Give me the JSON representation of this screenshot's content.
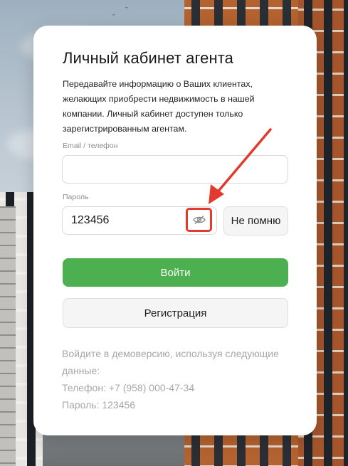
{
  "card": {
    "title": "Личный кабинет агента",
    "description": "Передавайте информацию о Ваших клиентах, желающих приобрести недвижимость в нашей компании. Личный кабинет доступен только зарегистрированным агентам."
  },
  "login_field": {
    "label": "Email / телефон",
    "value": "",
    "placeholder": ""
  },
  "password_field": {
    "label": "Пароль",
    "value": "123456",
    "toggle_icon": "eye-slash-icon"
  },
  "buttons": {
    "forgot": "Не помню",
    "login": "Войти",
    "register": "Регистрация"
  },
  "demo": {
    "line1": "Войдите в демоверсию, используя следующие данные:",
    "phone": "Телефон: +7 (958) 000-47-34",
    "password": "Пароль: 123456"
  },
  "colors": {
    "accent_green": "#4caf50",
    "annotation_red": "#e23b2e"
  }
}
